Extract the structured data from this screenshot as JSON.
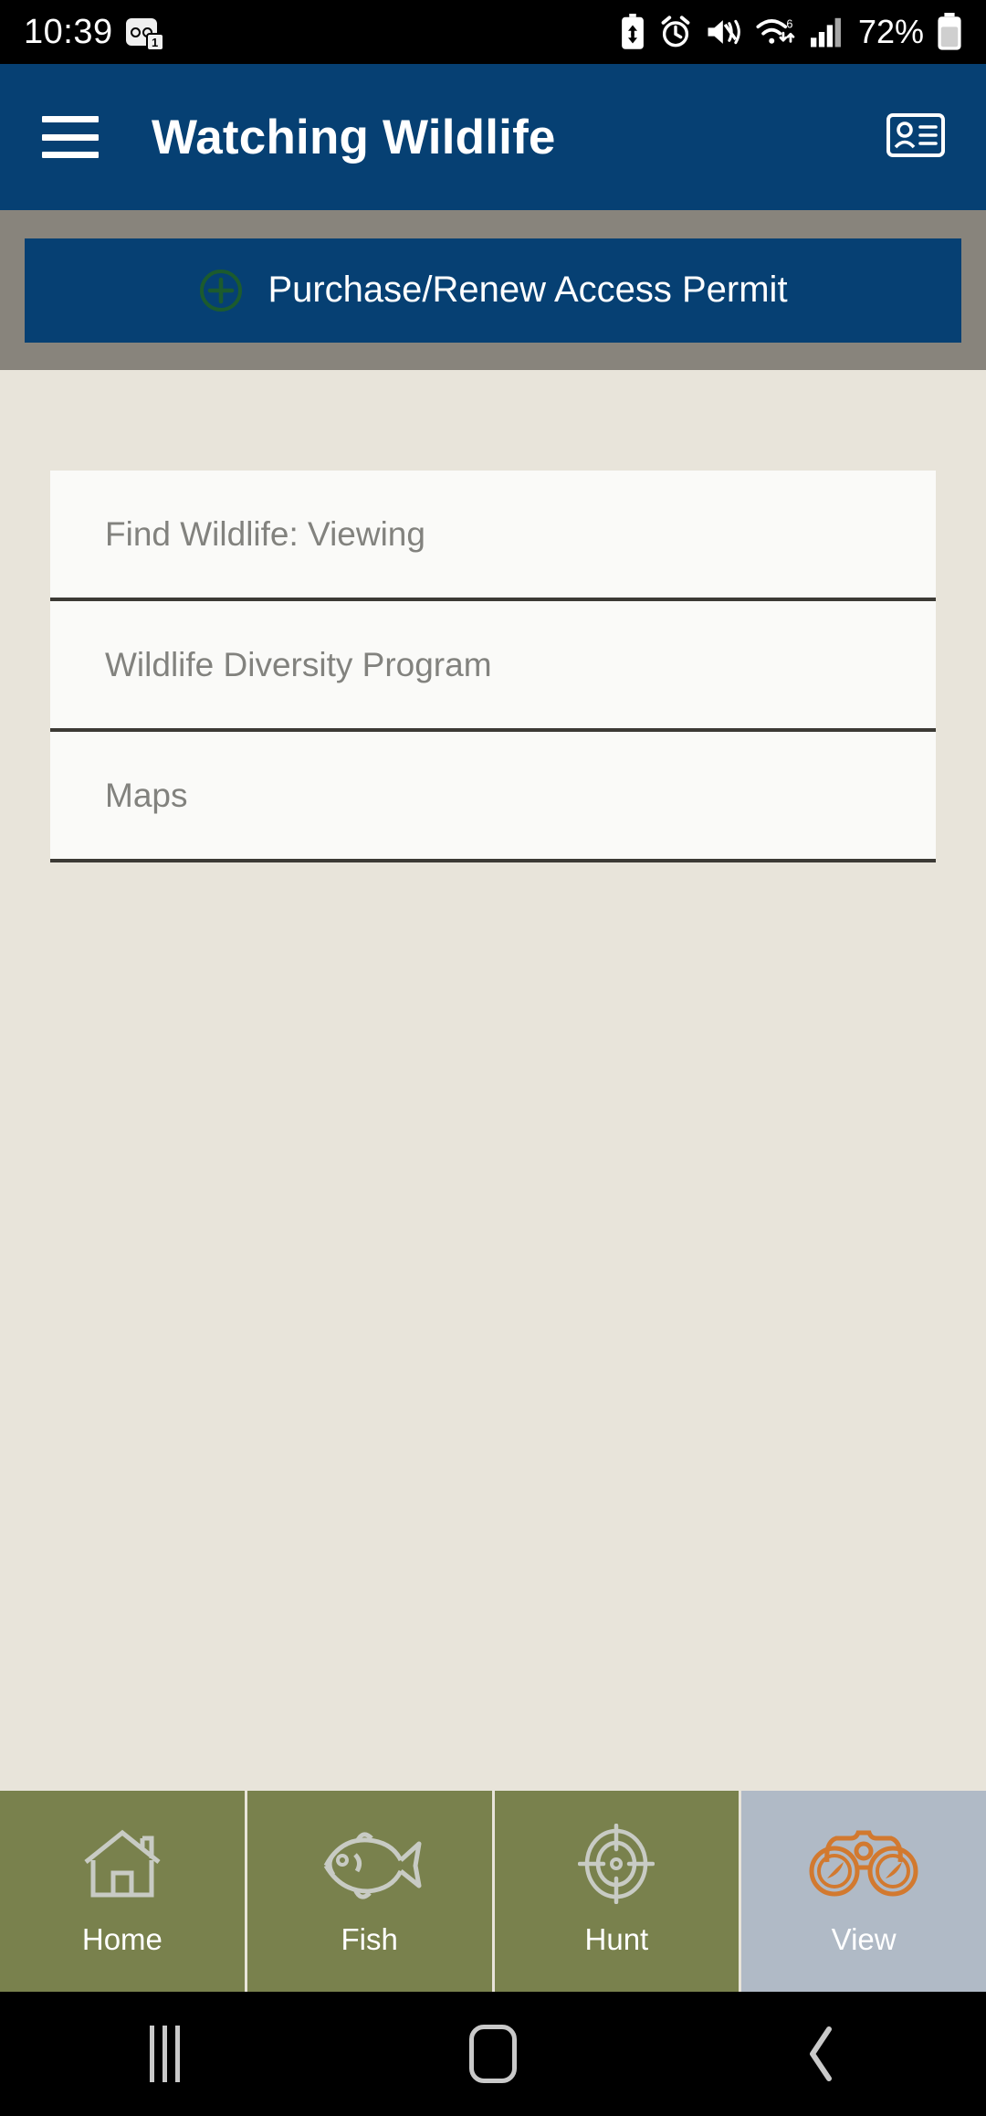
{
  "status_bar": {
    "time": "10:39",
    "notification_badge": "1",
    "notification_icon": "message-notification-icon",
    "icons": [
      "battery-saver-icon",
      "alarm-clock-icon",
      "vibrate-mute-icon",
      "wifi-6-icon",
      "cellular-signal-icon"
    ],
    "battery_percent": "72%",
    "battery_icon": "battery-icon"
  },
  "app_bar": {
    "menu_icon": "hamburger-menu-icon",
    "title": "Watching Wildlife",
    "action_icon": "id-card-icon"
  },
  "permit": {
    "icon": "plus-circle-icon",
    "label": "Purchase/Renew Access Permit"
  },
  "menu": {
    "items": [
      {
        "label": "Find Wildlife: Viewing"
      },
      {
        "label": "Wildlife Diversity Program"
      },
      {
        "label": "Maps"
      }
    ]
  },
  "tabs": [
    {
      "label": "Home",
      "icon": "house-icon",
      "active": false
    },
    {
      "label": "Fish",
      "icon": "fish-icon",
      "active": false
    },
    {
      "label": "Hunt",
      "icon": "crosshair-target-icon",
      "active": false
    },
    {
      "label": "View",
      "icon": "binoculars-icon",
      "active": true
    }
  ],
  "android_nav": {
    "recents": "recents-icon",
    "home": "home-pill-icon",
    "back": "back-chevron-icon"
  },
  "colors": {
    "app_bar_blue": "#064073",
    "band_gray": "#88847C",
    "page_bg": "#E8E4DA",
    "card_bg": "#FAFAF8",
    "divider": "#3C3A35",
    "tab_olive": "#79814D",
    "tab_active_bg": "#B0BAC6",
    "accent_orange": "#D2792F",
    "plus_green": "#1C5B2E"
  }
}
